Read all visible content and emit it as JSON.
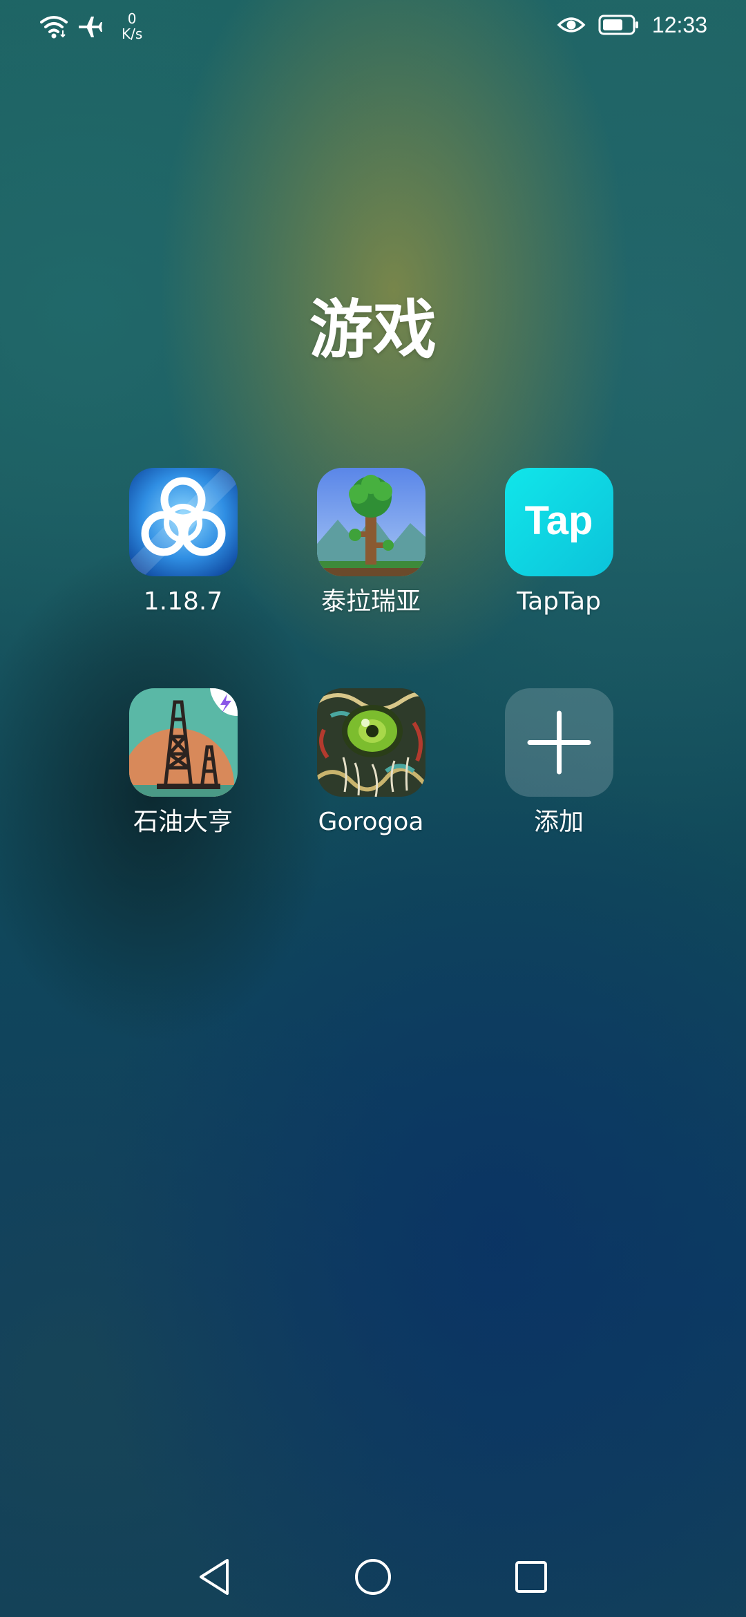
{
  "status_bar": {
    "network_speed_value": "0",
    "network_speed_unit": "K/s",
    "time": "12:33",
    "icons": [
      "wifi-icon",
      "airplane-mode-icon",
      "eye-comfort-icon",
      "battery-icon"
    ]
  },
  "folder": {
    "title": "游戏",
    "apps": [
      {
        "label": "1.18.7",
        "icon": "biohazard-app-icon"
      },
      {
        "label": "泰拉瑞亚",
        "icon": "terraria-tree-app-icon"
      },
      {
        "label": "TapTap",
        "icon": "taptap-app-icon",
        "icon_text": "Tap"
      },
      {
        "label": "石油大亨",
        "icon": "oil-rig-app-icon"
      },
      {
        "label": "Gorogoa",
        "icon": "gorogoa-eye-app-icon"
      },
      {
        "label": "添加",
        "icon": "add-icon"
      }
    ]
  },
  "nav_bar": {
    "buttons": [
      "back-icon",
      "home-icon",
      "recents-icon"
    ]
  },
  "colors": {
    "taptap_brand": "#13d8e2",
    "text": "#ffffff"
  }
}
